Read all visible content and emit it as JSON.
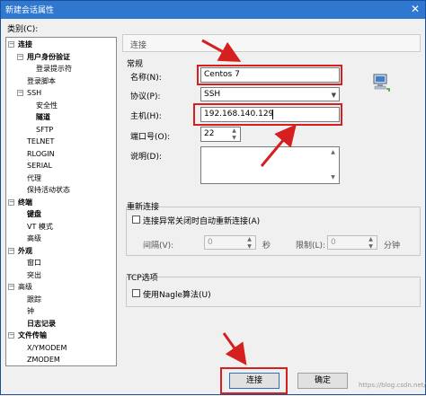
{
  "window": {
    "title": "新建会话属性"
  },
  "category": {
    "label": "类别(C):",
    "tree": [
      {
        "label": "连接",
        "bold": true,
        "toggle": "−",
        "level": 0
      },
      {
        "label": "用户身份验证",
        "bold": true,
        "toggle": "−",
        "level": 1
      },
      {
        "label": "登录提示符",
        "bold": false,
        "toggle": "",
        "level": 2
      },
      {
        "label": "登录脚本",
        "bold": false,
        "toggle": "",
        "level": 1
      },
      {
        "label": "SSH",
        "bold": false,
        "toggle": "−",
        "level": 1
      },
      {
        "label": "安全性",
        "bold": false,
        "toggle": "",
        "level": 2
      },
      {
        "label": "隧道",
        "bold": true,
        "toggle": "",
        "level": 2
      },
      {
        "label": "SFTP",
        "bold": false,
        "toggle": "",
        "level": 2
      },
      {
        "label": "TELNET",
        "bold": false,
        "toggle": "",
        "level": 1
      },
      {
        "label": "RLOGIN",
        "bold": false,
        "toggle": "",
        "level": 1
      },
      {
        "label": "SERIAL",
        "bold": false,
        "toggle": "",
        "level": 1
      },
      {
        "label": "代理",
        "bold": false,
        "toggle": "",
        "level": 1
      },
      {
        "label": "保持活动状态",
        "bold": false,
        "toggle": "",
        "level": 1
      },
      {
        "label": "终端",
        "bold": true,
        "toggle": "−",
        "level": 0
      },
      {
        "label": "键盘",
        "bold": true,
        "toggle": "",
        "level": 1
      },
      {
        "label": "VT 模式",
        "bold": false,
        "toggle": "",
        "level": 1
      },
      {
        "label": "高级",
        "bold": false,
        "toggle": "",
        "level": 1
      },
      {
        "label": "外观",
        "bold": true,
        "toggle": "−",
        "level": 0
      },
      {
        "label": "窗口",
        "bold": false,
        "toggle": "",
        "level": 1
      },
      {
        "label": "突出",
        "bold": false,
        "toggle": "",
        "level": 1
      },
      {
        "label": "高级",
        "bold": false,
        "toggle": "−",
        "level": 0
      },
      {
        "label": "跟踪",
        "bold": false,
        "toggle": "",
        "level": 1
      },
      {
        "label": "钟",
        "bold": false,
        "toggle": "",
        "level": 1
      },
      {
        "label": "日志记录",
        "bold": true,
        "toggle": "",
        "level": 1
      },
      {
        "label": "文件传输",
        "bold": true,
        "toggle": "−",
        "level": 0
      },
      {
        "label": "X/YMODEM",
        "bold": false,
        "toggle": "",
        "level": 1
      },
      {
        "label": "ZMODEM",
        "bold": false,
        "toggle": "",
        "level": 1
      }
    ]
  },
  "panel": {
    "header": "连接",
    "general": {
      "title": "常规",
      "name_label": "名称(N):",
      "name_value": "Centos 7",
      "protocol_label": "协议(P):",
      "protocol_value": "SSH",
      "host_label": "主机(H):",
      "host_value": "192.168.140.129",
      "port_label": "端口号(O):",
      "port_value": "22",
      "desc_label": "说明(D):",
      "desc_value": ""
    },
    "reconnect": {
      "title": "重新连接",
      "checkbox_label": "连接异常关闭时自动重新连接(A)",
      "interval_label": "间隔(V):",
      "interval_value": "0",
      "interval_unit": "秒",
      "limit_label": "限制(L):",
      "limit_value": "0",
      "limit_unit": "分钟"
    },
    "tcp": {
      "title": "TCP选项",
      "checkbox_label": "使用Nagle算法(U)"
    }
  },
  "buttons": {
    "connect": "连接",
    "ok": "确定"
  },
  "watermark": "https://blog.csdn.net/..."
}
